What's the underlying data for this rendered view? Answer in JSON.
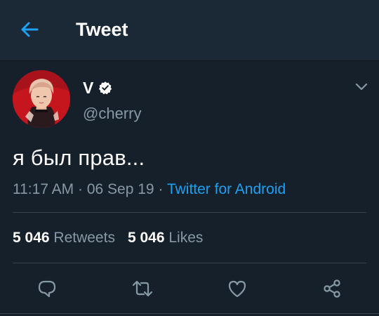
{
  "header": {
    "title": "Tweet",
    "back_icon": "arrow-left-icon"
  },
  "tweet": {
    "display_name": "V",
    "handle": "@cherry",
    "verified": true,
    "text": "я был прав...",
    "time": "11:17 AM",
    "date": "06 Sep 19",
    "separator": "·",
    "source": "Twitter for Android",
    "retweets_count": "5 046",
    "retweets_label": "Retweets",
    "likes_count": "5 046",
    "likes_label": "Likes"
  },
  "actions": {
    "reply_icon": "comment-icon",
    "retweet_icon": "retweet-icon",
    "like_icon": "heart-icon",
    "share_icon": "share-icon"
  },
  "colors": {
    "background": "#15202b",
    "header_background": "#1b2836",
    "accent": "#1da1f2",
    "secondary_text": "#8899a6",
    "divider": "#38444d"
  }
}
